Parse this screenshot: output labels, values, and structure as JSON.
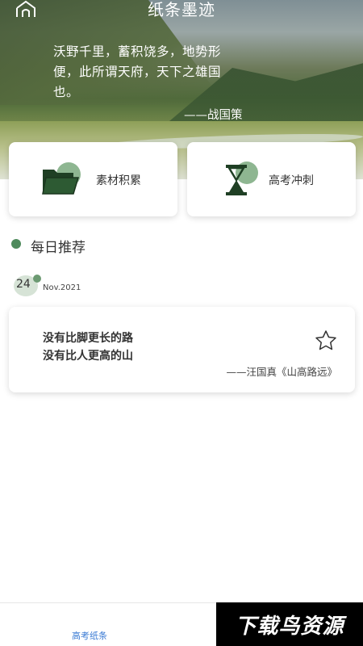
{
  "header": {
    "app_title": "纸条墨迹",
    "quote": "沃野千里，蓄积饶多，地势形便，此所谓天府，天下之雄国也。",
    "quote_source": "——战国策"
  },
  "categories": [
    {
      "label": "素材积累",
      "icon": "folder-icon"
    },
    {
      "label": "高考冲刺",
      "icon": "hourglass-icon"
    }
  ],
  "section": {
    "title": "每日推荐",
    "date_day": "24",
    "date_month": "Nov.2021"
  },
  "recommendation": {
    "line1": "没有比脚更长的路",
    "line2": "没有比人更高的山",
    "source": "——汪国真《山高路远》"
  },
  "bottom_nav": {
    "home_label": "高考纸条"
  },
  "watermark": "下载鸟资源",
  "colors": {
    "accent_green": "#4e8a5c",
    "nav_active": "#3b7bd4"
  }
}
